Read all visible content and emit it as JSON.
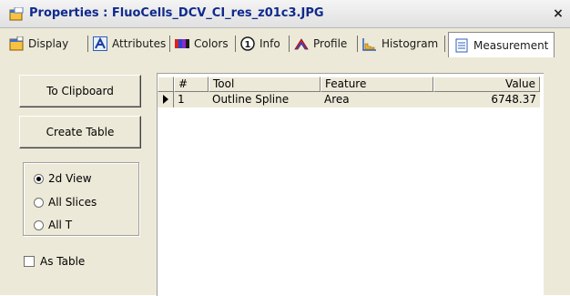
{
  "window": {
    "title": "Properties : FluoCells_DCV_CI_res_z01c3.JPG",
    "close_label": "×"
  },
  "tabs": [
    {
      "label": "Display",
      "icon": "display-icon"
    },
    {
      "label": "Attributes",
      "icon": "attributes-icon"
    },
    {
      "label": "Colors",
      "icon": "colors-icon"
    },
    {
      "label": "Info",
      "icon": "info-icon"
    },
    {
      "label": "Profile",
      "icon": "profile-icon"
    },
    {
      "label": "Histogram",
      "icon": "histogram-icon"
    },
    {
      "label": "Measurement",
      "icon": "measurement-icon",
      "active": true
    }
  ],
  "buttons": {
    "clipboard": "To Clipboard",
    "create_table": "Create Table"
  },
  "view_group": {
    "options": [
      "2d View",
      "All Slices",
      "All T"
    ],
    "selected": "2d View"
  },
  "as_table": {
    "label": "As Table",
    "checked": false
  },
  "table": {
    "columns": [
      "#",
      "Tool",
      "Feature",
      "Value"
    ],
    "rows": [
      {
        "num": "1",
        "tool": "Outline Spline",
        "feature": "Area",
        "value": "6748.37"
      }
    ]
  },
  "colors": {
    "title_text": "#0f2a8c",
    "panel_bg": "#ece9d8"
  }
}
